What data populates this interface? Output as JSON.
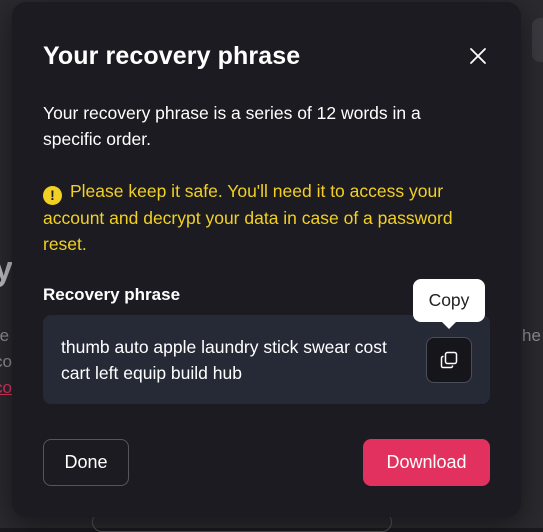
{
  "modal": {
    "title": "Your recovery phrase",
    "description": "Your recovery phrase is a series of 12 words in a specific order.",
    "warning": "Please keep it safe. You'll need it to access your account and decrypt your data in case of a password reset.",
    "warning_icon": "exclamation-circle-icon",
    "phrase_label": "Recovery phrase",
    "phrase": "thumb auto apple laundry stick swear cost cart left equip build hub",
    "copy_tooltip": "Copy",
    "done_label": "Done",
    "download_label": "Download",
    "colors": {
      "accent": "#e2315e",
      "warning": "#f2d024",
      "surface": "#1c1b21",
      "phrase_bg": "#262a37"
    }
  },
  "background": {
    "glyph": "y",
    "line_1": "re",
    "line_2": "co",
    "link": "co",
    "right_text": "he"
  }
}
